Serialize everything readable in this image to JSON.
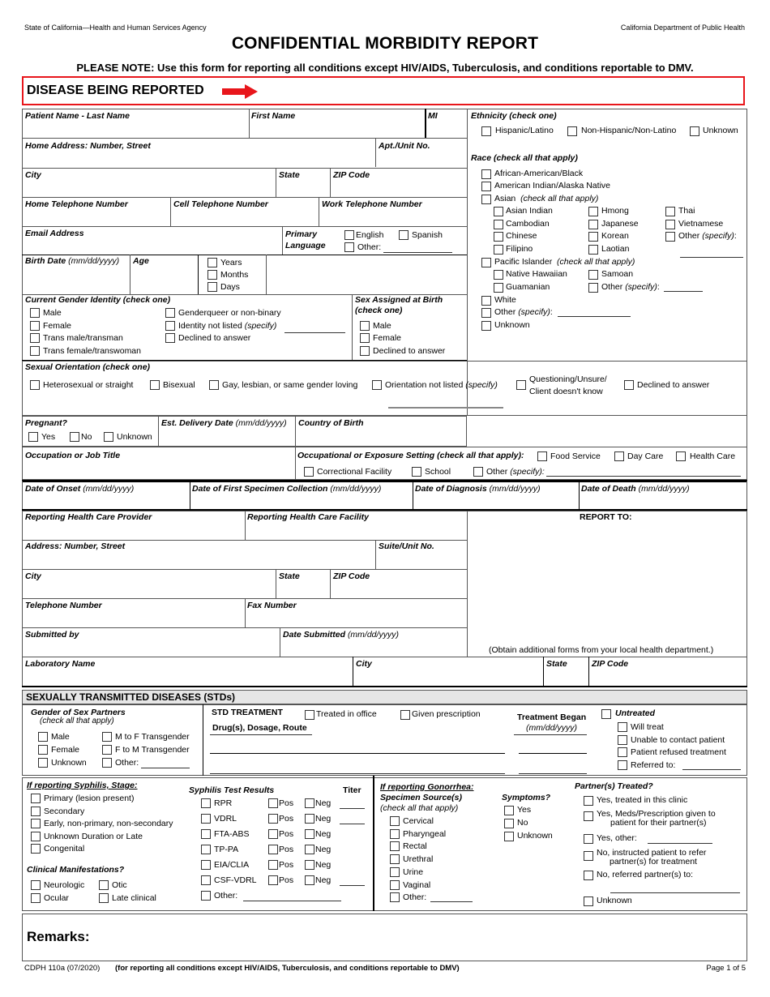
{
  "header": {
    "agency_left": "State of California—Health and Human Services Agency",
    "agency_right": "California Department of Public Health",
    "title": "CONFIDENTIAL MORBIDITY REPORT",
    "note": "PLEASE NOTE:  Use this form for reporting all conditions except HIV/AIDS, Tuberculosis, and conditions reportable to DMV.",
    "disease_label": "DISEASE BEING REPORTED",
    "accent_color": "#e8161b"
  },
  "patient": {
    "last_name": "Patient Name - Last Name",
    "first_name": "First Name",
    "mi": "MI",
    "home_address": "Home Address:  Number, Street",
    "apt": "Apt./Unit No.",
    "city": "City",
    "state": "State",
    "zip": "ZIP Code",
    "home_phone": "Home Telephone Number",
    "cell_phone": "Cell Telephone Number",
    "work_phone": "Work Telephone Number",
    "email": "Email Address",
    "primary_language": "Primary",
    "primary_language2": "Language",
    "lang_options": [
      "English",
      "Spanish",
      "Other:"
    ],
    "birth_date": "Birth Date",
    "date_fmt": "(mm/dd/yyyy)",
    "age": "Age",
    "age_units": [
      "Years",
      "Months",
      "Days"
    ],
    "gender_identity": "Current Gender Identity (check one)",
    "gender_options": [
      "Male",
      "Female",
      "Trans male/transman",
      "Trans female/transwoman",
      "Genderqueer or non-binary",
      "Identity not listed",
      "Declined to answer"
    ],
    "specify": "(specify)",
    "sex_at_birth": "Sex Assigned at Birth",
    "check_one": "(check one)",
    "sex_options": [
      "Male",
      "Female",
      "Declined to answer"
    ]
  },
  "ethnicity": {
    "label": "Ethnicity (check one)",
    "options": [
      "Hispanic/Latino",
      "Non-Hispanic/Non-Latino",
      "Unknown"
    ],
    "race_label": "Race (check all that apply)",
    "race_top": [
      "African-American/Black",
      "American Indian/Alaska Native"
    ],
    "asian": "Asian",
    "check_all": "(check all that apply)",
    "asian_col1": [
      "Asian Indian",
      "Cambodian",
      "Chinese",
      "Filipino"
    ],
    "asian_col2": [
      "Hmong",
      "Japanese",
      "Korean",
      "Laotian"
    ],
    "asian_col3": [
      "Thai",
      "Vietnamese",
      "Other"
    ],
    "pacific": "Pacific Islander",
    "pacific_col1": [
      "Native Hawaiian",
      "Guamanian"
    ],
    "pacific_col2": [
      "Samoan",
      "Other"
    ],
    "race_bottom": [
      "White",
      "Other",
      "Unknown"
    ],
    "specify": "(specify)"
  },
  "orientation": {
    "label": "Sexual Orientation (check one)",
    "options": [
      "Heterosexual or straight",
      "Bisexual",
      "Gay, lesbian, or same gender loving",
      "Orientation not listed",
      "Questioning/Unsure/",
      "Client doesn't know",
      "Declined to answer"
    ],
    "specify": "(specify)"
  },
  "pregnancy": {
    "pregnant": "Pregnant?",
    "options": [
      "Yes",
      "No",
      "Unknown"
    ],
    "delivery": "Est. Delivery Date",
    "date_fmt": "(mm/dd/yyyy)",
    "country": "Country of Birth",
    "occupation": "Occupation or Job Title",
    "setting": "Occupational or Exposure Setting (check all that apply):",
    "setting_options": [
      "Food Service",
      "Day Care",
      "Health Care",
      "Correctional Facility",
      "School",
      "Other"
    ],
    "specify": "(specify):"
  },
  "dates": {
    "onset": "Date of Onset",
    "specimen": "Date of First Specimen Collection",
    "diagnosis": "Date of Diagnosis",
    "death": "Date of Death",
    "fmt": "(mm/dd/yyyy)"
  },
  "provider": {
    "provider": "Reporting Health Care Provider",
    "facility": "Reporting Health Care Facility",
    "address": "Address:  Number, Street",
    "suite": "Suite/Unit No.",
    "city": "City",
    "state": "State",
    "zip": "ZIP Code",
    "phone": "Telephone Number",
    "fax": "Fax Number",
    "submitted_by": "Submitted by",
    "date_submitted": "Date Submitted",
    "fmt": "(mm/dd/yyyy)",
    "report_to": "REPORT TO:",
    "obtain": "(Obtain additional forms from your local health department.)",
    "lab_name": "Laboratory Name",
    "lab_city": "City",
    "lab_state": "State",
    "lab_zip": "ZIP Code"
  },
  "std": {
    "title": "SEXUALLY TRANSMITTED DISEASES (STDs)",
    "gender_partners": "Gender of Sex Partners",
    "check_all": "(check all that apply)",
    "partner_col1": [
      "Male",
      "Female",
      "Unknown"
    ],
    "partner_col2": [
      "M to F Transgender",
      "F to M Transgender",
      "Other:"
    ],
    "treatment": "STD TREATMENT",
    "treated_office": "Treated in office",
    "given_rx": "Given prescription",
    "drugs": "Drug(s), Dosage, Route",
    "treatment_began": "Treatment Began",
    "fmt": "(mm/dd/yyyy)",
    "untreated": "Untreated",
    "untreated_options": [
      "Will treat",
      "Unable to contact patient",
      "Patient refused treatment",
      "Referred to:"
    ],
    "syphilis_stage": "If reporting Syphilis, Stage:",
    "stage_options": [
      "Primary (lesion present)",
      "Secondary",
      "Early, non-primary, non-secondary",
      "Unknown Duration or Late",
      "Congenital"
    ],
    "clinical": "Clinical Manifestations?",
    "clinical_col1": [
      "Neurologic",
      "Ocular"
    ],
    "clinical_col2": [
      "Otic",
      "Late clinical"
    ],
    "test_results": "Syphilis Test Results",
    "titer": "Titer",
    "tests": [
      "RPR",
      "VDRL",
      "FTA-ABS",
      "TP-PA",
      "EIA/CLIA",
      "CSF-VDRL",
      "Other:"
    ],
    "pos": "Pos",
    "neg": "Neg",
    "gonorrhea": "If reporting Gonorrhea:",
    "specimen_source": "Specimen Source(s)",
    "specimen_options": [
      "Cervical",
      "Pharyngeal",
      "Rectal",
      "Urethral",
      "Urine",
      "Vaginal",
      "Other:"
    ],
    "symptoms": "Symptoms?",
    "symptom_options": [
      "Yes",
      "No",
      "Unknown"
    ],
    "partners_treated": "Partner(s) Treated?",
    "pt_options": [
      "Yes, treated in this clinic",
      "Yes, Meds/Prescription given to",
      "patient for their partner(s)",
      "Yes, other:",
      "No, instructed patient to refer",
      "partner(s) for treatment",
      "No, referred partner(s) to:",
      "Unknown"
    ]
  },
  "remarks": "Remarks:",
  "footer": {
    "form_id": "CDPH 110a (07/2020)",
    "form_note": "(for reporting all conditions except HIV/AIDS, Tuberculosis, and conditions reportable to DMV)",
    "page": "Page 1 of 5"
  }
}
